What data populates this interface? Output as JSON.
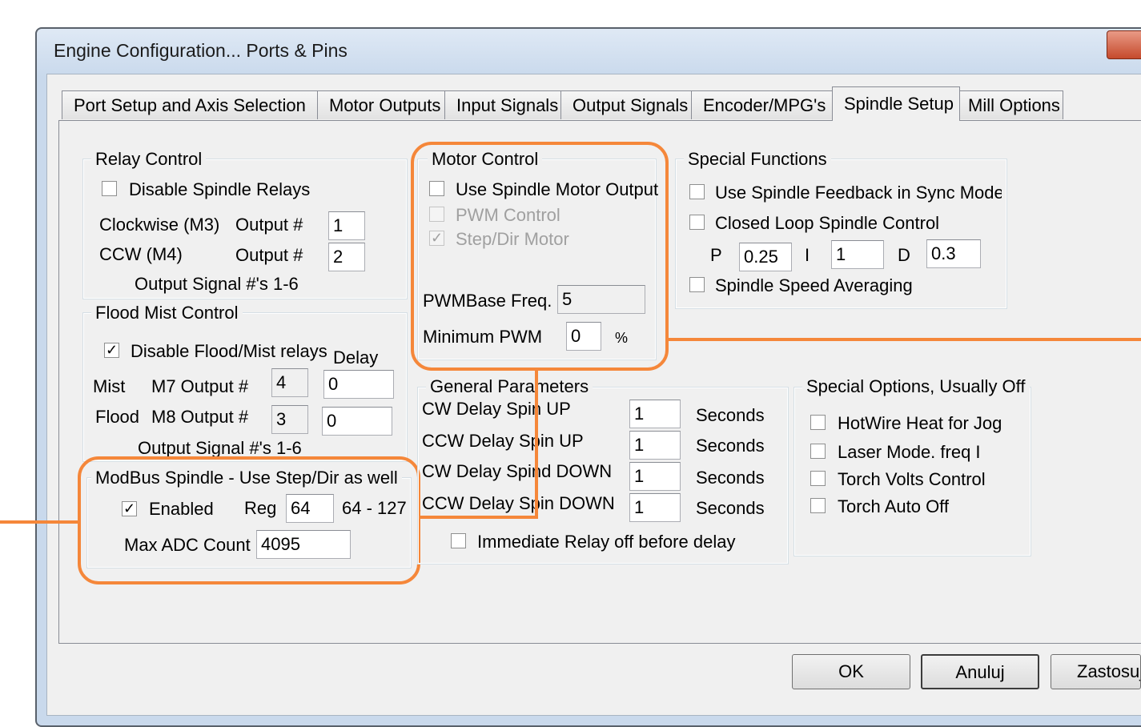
{
  "window": {
    "title": "Engine Configuration... Ports & Pins"
  },
  "tabs": [
    "Port Setup and Axis Selection",
    "Motor Outputs",
    "Input Signals",
    "Output Signals",
    "Encoder/MPG's",
    "Spindle Setup",
    "Mill Options"
  ],
  "relay_control": {
    "title": "Relay Control",
    "disable_label": "Disable Spindle Relays",
    "disable_checked": false,
    "cw_label": "Clockwise (M3)",
    "ccw_label": "CCW (M4)",
    "output_label": "Output #",
    "cw_output": "1",
    "ccw_output": "2",
    "signal_note": "Output Signal #'s 1-6"
  },
  "flood_mist": {
    "title": "Flood Mist Control",
    "disable_label": "Disable Flood/Mist relays",
    "disable_checked": true,
    "delay_header": "Delay",
    "mist_label": "Mist",
    "mist_output_label": "M7 Output #",
    "mist_output": "4",
    "mist_delay": "0",
    "flood_label": "Flood",
    "flood_output_label": "M8 Output #",
    "flood_output": "3",
    "flood_delay": "0",
    "signal_note": "Output Signal #'s 1-6"
  },
  "modbus": {
    "title": "ModBus Spindle - Use Step/Dir as well",
    "enabled_label": "Enabled",
    "enabled_checked": true,
    "reg_label": "Reg",
    "reg_value": "64",
    "reg_range": "64 - 127",
    "max_adc_label": "Max ADC Count",
    "max_adc_value": "4095"
  },
  "motor_control": {
    "title": "Motor Control",
    "use_motor_label": "Use Spindle Motor Output",
    "pwm_label": "PWM Control",
    "stepdir_label": "Step/Dir Motor",
    "stepdir_checked": true,
    "pwm_freq_label": "PWMBase Freq.",
    "pwm_freq_value": "5",
    "min_pwm_label": "Minimum PWM",
    "min_pwm_value": "0",
    "min_pwm_unit": "%"
  },
  "general": {
    "title": "General Parameters",
    "rows": [
      {
        "label": "CW Delay Spin UP",
        "value": "1",
        "unit": "Seconds"
      },
      {
        "label": "CCW Delay Spin UP",
        "value": "1",
        "unit": "Seconds"
      },
      {
        "label": "CW Delay Spind DOWN",
        "value": "1",
        "unit": "Seconds"
      },
      {
        "label": "CCW Delay Spin DOWN",
        "value": "1",
        "unit": "Seconds"
      }
    ],
    "immediate_label": "Immediate Relay off before delay"
  },
  "special_functions": {
    "title": "Special Functions",
    "feedback_label": "Use Spindle Feedback in Sync Modes",
    "closed_loop_label": "Closed Loop Spindle Control",
    "p_label": "P",
    "p_value": "0.25",
    "i_label": "I",
    "i_value": "1",
    "d_label": "D",
    "d_value": "0.3",
    "averaging_label": "Spindle Speed Averaging"
  },
  "special_options": {
    "title": "Special Options, Usually Off",
    "items": [
      "HotWire Heat for Jog",
      "Laser Mode. freq I",
      "Torch Volts Control",
      "Torch Auto Off"
    ]
  },
  "buttons": {
    "ok": "OK",
    "cancel": "Anuluj",
    "apply": "Zastosuj"
  },
  "colors": {
    "highlight": "#f5873a",
    "title_bar": "#c9d9ec",
    "panel": "#f0f0f0"
  },
  "icons": {
    "check": "✓"
  }
}
